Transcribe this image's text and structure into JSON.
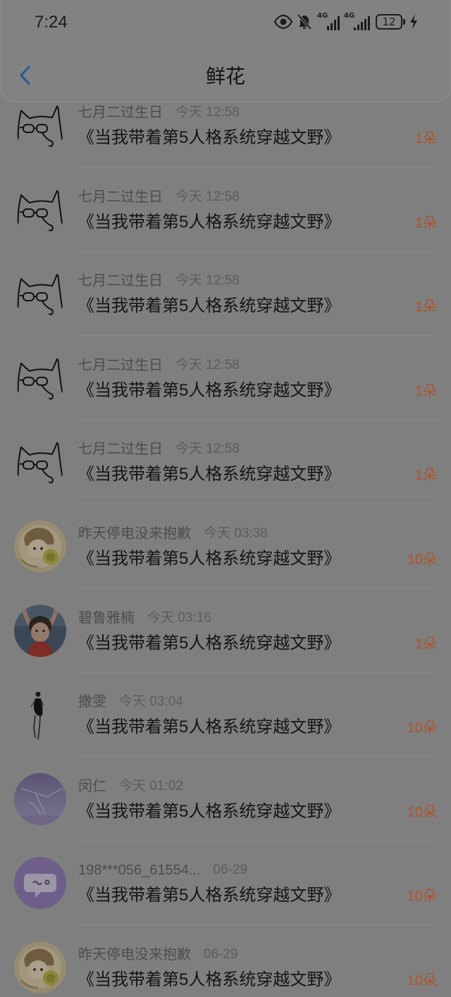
{
  "status_bar": {
    "time": "7:24",
    "network_1": "4G",
    "network_2": "4G",
    "battery": "12"
  },
  "header": {
    "title": "鲜花"
  },
  "colors": {
    "accent": "#1f5c9c",
    "count": "#b0532c",
    "bg": "#7f7f7f"
  },
  "items": [
    {
      "username": "七月二过生日",
      "time": "今天 12:58",
      "book": "《当我带着第5人格系统穿越文野》",
      "count": "1朵"
    },
    {
      "username": "七月二过生日",
      "time": "今天 12:58",
      "book": "《当我带着第5人格系统穿越文野》",
      "count": "1朵"
    },
    {
      "username": "七月二过生日",
      "time": "今天 12:58",
      "book": "《当我带着第5人格系统穿越文野》",
      "count": "1朵"
    },
    {
      "username": "七月二过生日",
      "time": "今天 12:58",
      "book": "《当我带着第5人格系统穿越文野》",
      "count": "1朵"
    },
    {
      "username": "七月二过生日",
      "time": "今天 12:58",
      "book": "《当我带着第5人格系统穿越文野》",
      "count": "1朵"
    },
    {
      "username": "昨天停电没来抱歉",
      "time": "今天 03:38",
      "book": "《当我带着第5人格系统穿越文野》",
      "count": "10朵"
    },
    {
      "username": "碧鲁雅楠",
      "time": "今天 03:16",
      "book": "《当我带着第5人格系统穿越文野》",
      "count": "1朵"
    },
    {
      "username": "撒雯",
      "time": "今天 03:04",
      "book": "《当我带着第5人格系统穿越文野》",
      "count": "10朵"
    },
    {
      "username": "闵仁",
      "time": "今天 01:02",
      "book": "《当我带着第5人格系统穿越文野》",
      "count": "10朵"
    },
    {
      "username": "198***056_61554...",
      "time": "06-29",
      "book": "《当我带着第5人格系统穿越文野》",
      "count": "10朵"
    },
    {
      "username": "昨天停电没来抱歉",
      "time": "06-29",
      "book": "《当我带着第5人格系统穿越文野》",
      "count": "10朵"
    }
  ]
}
